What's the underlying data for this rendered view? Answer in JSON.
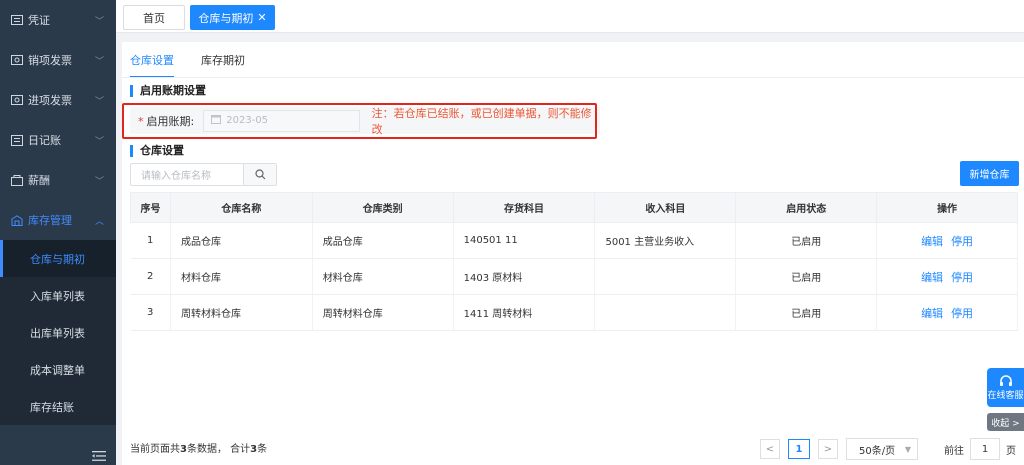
{
  "sidebar": {
    "items": [
      {
        "label": "凭证",
        "icon": "voucher-icon"
      },
      {
        "label": "销项发票",
        "icon": "invoice-out-icon"
      },
      {
        "label": "进项发票",
        "icon": "invoice-in-icon"
      },
      {
        "label": "日记账",
        "icon": "journal-icon"
      },
      {
        "label": "薪酬",
        "icon": "salary-icon"
      },
      {
        "label": "库存管理",
        "icon": "warehouse-icon"
      }
    ],
    "sub_items": [
      "仓库与期初",
      "入库单列表",
      "出库单列表",
      "成本调整单",
      "库存结账"
    ]
  },
  "tabs": {
    "home": "首页",
    "active": "仓库与期初",
    "close": "✕"
  },
  "subtabs": [
    "仓库设置",
    "库存期初"
  ],
  "period_section": {
    "title": "启用账期设置",
    "required_mark": "*",
    "label": "启用账期:",
    "value": "2023-05",
    "note": "注：若仓库已结账，或已创建单据，则不能修改"
  },
  "warehouse_section": {
    "title": "仓库设置",
    "search_placeholder": "请输入仓库名称",
    "add_button": "新增仓库"
  },
  "table": {
    "headers": [
      "序号",
      "仓库名称",
      "仓库类别",
      "存货科目",
      "收入科目",
      "启用状态",
      "操作"
    ],
    "rows": [
      {
        "no": "1",
        "name": "成品仓库",
        "category": "成品仓库",
        "stock_account": "140501 11",
        "income_account": "5001 主营业务收入",
        "status": "已启用"
      },
      {
        "no": "2",
        "name": "材料仓库",
        "category": "材料仓库",
        "stock_account": "1403 原材料",
        "income_account": "",
        "status": "已启用"
      },
      {
        "no": "3",
        "name": "周转材料仓库",
        "category": "周转材料仓库",
        "stock_account": "1411 周转材料",
        "income_account": "",
        "status": "已启用"
      }
    ],
    "edit_label": "编辑",
    "disable_label": "停用"
  },
  "footer": {
    "prefix": "当前页面共",
    "count": "3",
    "mid": "条数据，  合计",
    "total": "3",
    "suffix": "条"
  },
  "pagination": {
    "prev": "<",
    "current_page": "1",
    "next": ">",
    "page_size": "50条/页",
    "goto_label": "前往",
    "goto_value": "1",
    "page_unit": "页"
  },
  "service": {
    "label": "在线客服",
    "collapse": "收起 >"
  },
  "colors": {
    "accent": "#1e88ff",
    "sidebar_bg": "#2b3a4a",
    "highlight": "#e0271e",
    "note": "#ee5533"
  }
}
